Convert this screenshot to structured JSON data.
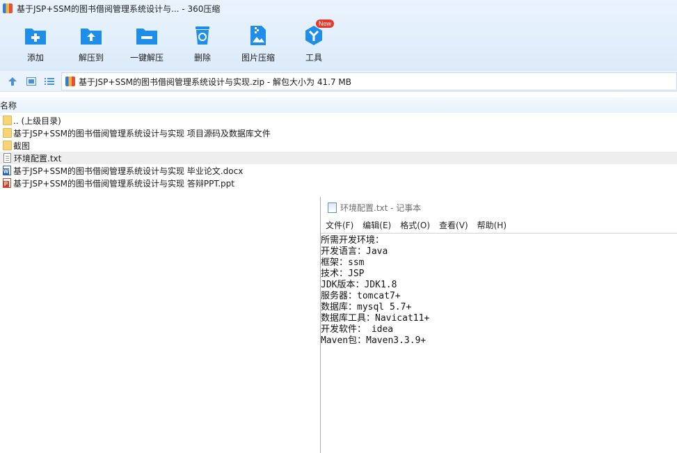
{
  "window": {
    "title": "基于JSP+SSM的图书借阅管理系统设计与... - 360压缩"
  },
  "toolbar": {
    "items": [
      {
        "label": "添加",
        "icon": "add-icon"
      },
      {
        "label": "解压到",
        "icon": "extract-to-icon"
      },
      {
        "label": "一键解压",
        "icon": "one-click-extract-icon"
      },
      {
        "label": "删除",
        "icon": "delete-icon"
      },
      {
        "label": "图片压缩",
        "icon": "image-compress-icon"
      },
      {
        "label": "工具",
        "icon": "tools-icon",
        "badge": "New"
      }
    ],
    "accent": "#1e8ee8",
    "badge_color": "#e8382e"
  },
  "address": {
    "path": "基于JSP+SSM的图书借阅管理系统设计与实现.zip - 解包大小为 41.7 MB"
  },
  "list": {
    "column_name": "名称",
    "rows": [
      {
        "name": ".. (上级目录)",
        "type": "folder"
      },
      {
        "name": "基于JSP+SSM的图书借阅管理系统设计与实现 项目源码及数据库文件",
        "type": "folder"
      },
      {
        "name": "截图",
        "type": "folder"
      },
      {
        "name": "环境配置.txt",
        "type": "txt",
        "selected": true
      },
      {
        "name": "基于JSP+SSM的图书借阅管理系统设计与实现 毕业论文.docx",
        "type": "docx"
      },
      {
        "name": "基于JSP+SSM的图书借阅管理系统设计与实现 答辩PPT.ppt",
        "type": "ppt"
      }
    ]
  },
  "notepad": {
    "title": "环境配置.txt - 记事本",
    "menu": [
      "文件(F)",
      "编辑(E)",
      "格式(O)",
      "查看(V)",
      "帮助(H)"
    ],
    "lines": [
      "所需开发环境：",
      "开发语言：Java",
      "框架：ssm",
      "技术：JSP",
      "JDK版本：JDK1.8",
      "服务器：tomcat7+",
      "数据库：mysql 5.7+",
      "数据库工具：Navicat11+",
      "开发软件： idea",
      "Maven包：Maven3.3.9+"
    ]
  }
}
